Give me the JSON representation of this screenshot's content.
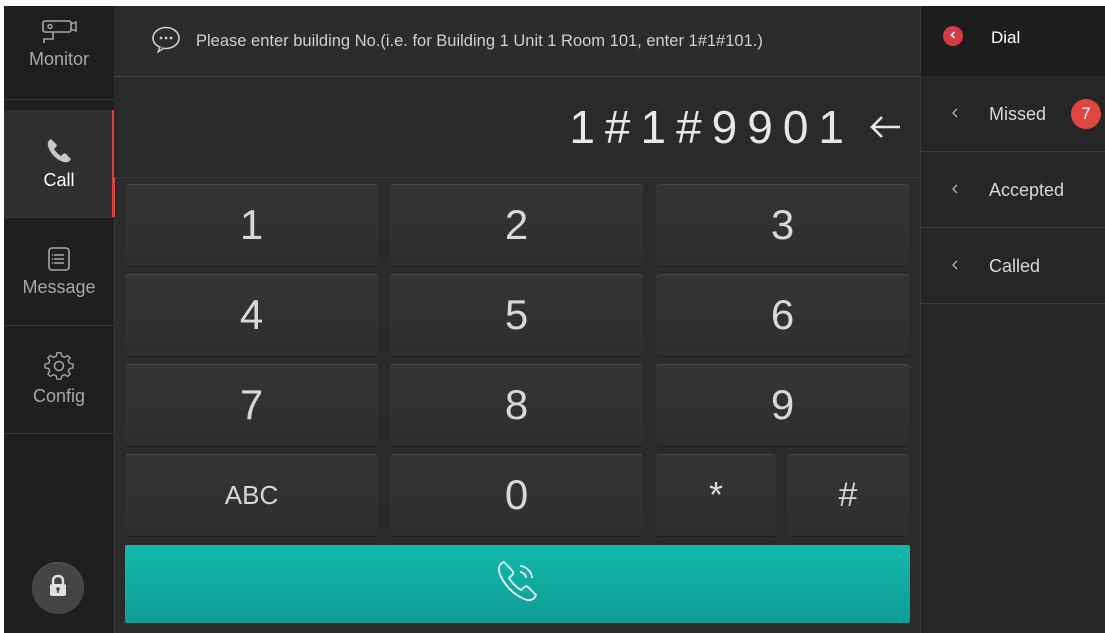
{
  "nav": {
    "monitor_label": "Monitor",
    "call_label": "Call",
    "message_label": "Message",
    "config_label": "Config",
    "active_item": "Call",
    "active_color": "#d6403d"
  },
  "hint": {
    "text": "Please enter building No.(i.e. for Building 1 Unit 1 Room 101, enter 1#1#101.)"
  },
  "display": {
    "number": "1#1#9901"
  },
  "keypad": {
    "k1": "1",
    "k2": "2",
    "k3": "3",
    "k4": "4",
    "k5": "5",
    "k6": "6",
    "k7": "7",
    "k8": "8",
    "k9": "9",
    "abc": "ABC",
    "k0": "0",
    "star": "*",
    "hash": "#"
  },
  "call_button": {
    "color": "#14b8ad",
    "icon": "phone-call-icon"
  },
  "right_panel": {
    "title": "Dial",
    "items": [
      {
        "label": "Missed",
        "badge": "7"
      },
      {
        "label": "Accepted"
      },
      {
        "label": "Called"
      }
    ],
    "badge_color": "#e0453f"
  }
}
